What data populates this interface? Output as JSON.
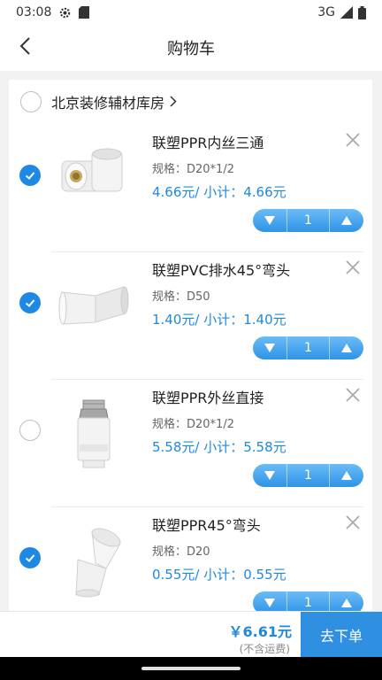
{
  "status_bar": {
    "time": "03:08",
    "network": "3G"
  },
  "header": {
    "title": "购物车"
  },
  "store": {
    "name": "北京装修辅材库房",
    "checked": false
  },
  "products": [
    {
      "title": "联塑PPR内丝三通",
      "spec": "规格：D20*1/2",
      "price_line": "4.66元/  小计：4.66元",
      "quantity": "1",
      "checked": true,
      "image": "ppr-female-tee"
    },
    {
      "title": "联塑PVC排水45°弯头",
      "spec": "规格：D50",
      "price_line": "1.40元/  小计：1.40元",
      "quantity": "1",
      "checked": true,
      "image": "pvc-45-elbow"
    },
    {
      "title": "联塑PPR外丝直接",
      "spec": "规格：D20*1/2",
      "price_line": "5.58元/  小计：5.58元",
      "quantity": "1",
      "checked": false,
      "image": "ppr-male-coupling"
    },
    {
      "title": "联塑PPR45°弯头",
      "spec": "规格：D20",
      "price_line": "0.55元/  小计：0.55元",
      "quantity": "1",
      "checked": true,
      "image": "ppr-45-elbow"
    }
  ],
  "bottom": {
    "total": "￥6.61元",
    "shipping_note": "(不含运费)",
    "checkout_label": "去下单"
  },
  "colors": {
    "accent": "#1e88e5",
    "checkout": "#2f8fe0",
    "background": "#f2f2f2"
  },
  "icons": {
    "back": "chevron-left-icon",
    "remove": "close-icon",
    "store_link": "chevron-right-icon",
    "decrease": "triangle-down-icon",
    "increase": "triangle-up-icon"
  }
}
